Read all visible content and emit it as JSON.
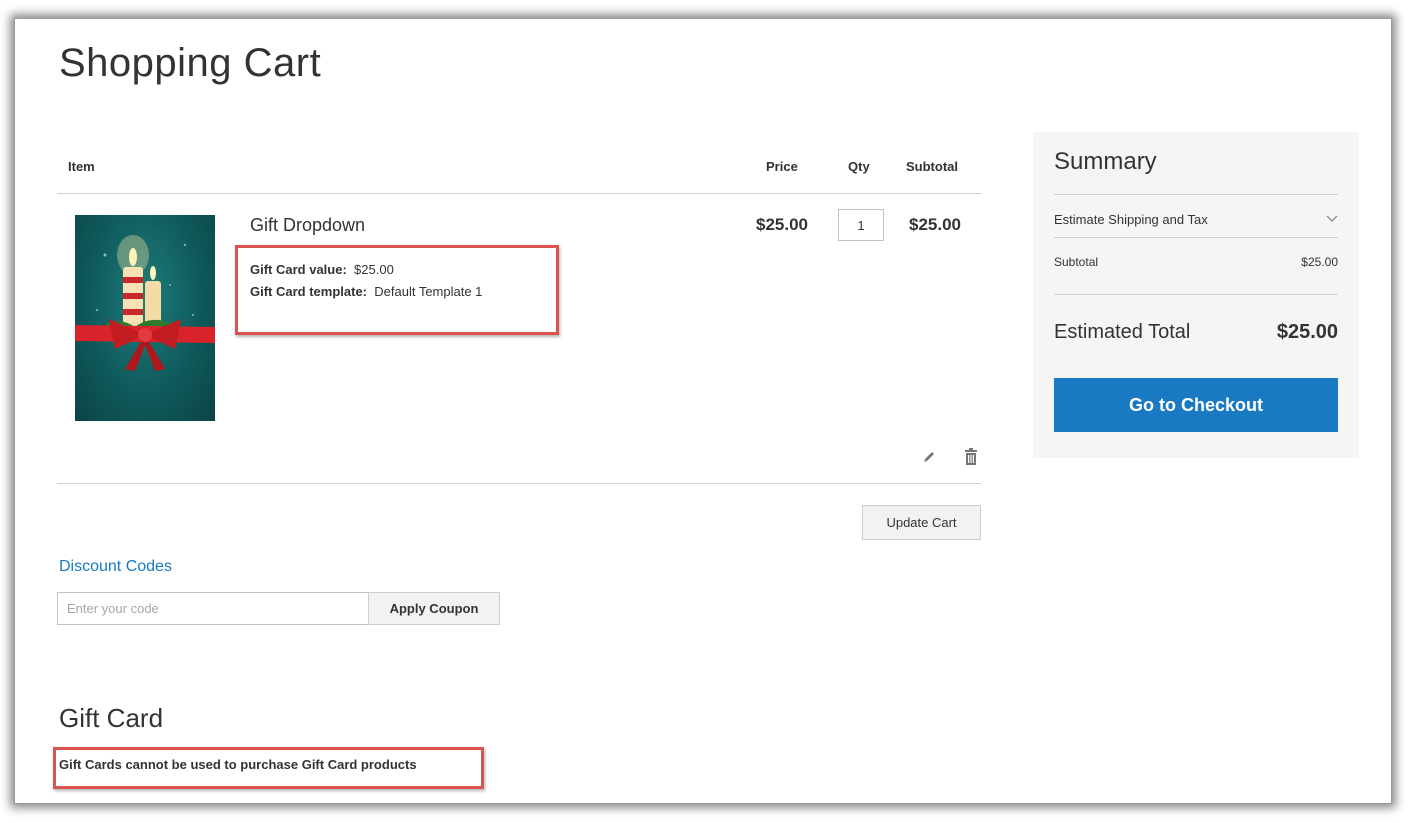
{
  "page": {
    "title": "Shopping Cart"
  },
  "cart_table": {
    "headers": {
      "item": "Item",
      "price": "Price",
      "qty": "Qty",
      "subtotal": "Subtotal"
    },
    "item": {
      "name": "Gift Dropdown",
      "options": [
        {
          "label": "Gift Card value:",
          "value": "$25.00"
        },
        {
          "label": "Gift Card template:",
          "value": "Default Template 1"
        }
      ],
      "price": "$25.00",
      "qty": "1",
      "subtotal": "$25.00",
      "edit_icon": "pencil-icon",
      "delete_icon": "trash-icon"
    },
    "update_label": "Update Cart"
  },
  "discount": {
    "title": "Discount Codes",
    "placeholder": "Enter your code",
    "apply_label": "Apply Coupon"
  },
  "gift_card": {
    "title": "Gift Card",
    "note": "Gift Cards cannot be used to purchase Gift Card products"
  },
  "summary": {
    "title": "Summary",
    "shipping_label": "Estimate Shipping and Tax",
    "chevron_icon": "chevron-down-icon",
    "subtotal_label": "Subtotal",
    "subtotal_value": "$25.00",
    "total_label": "Estimated Total",
    "total_value": "$25.00",
    "checkout_label": "Go to Checkout"
  },
  "colors": {
    "accent": "#1979c3",
    "highlight": "#d9534f",
    "summary_bg": "#f5f5f5"
  }
}
